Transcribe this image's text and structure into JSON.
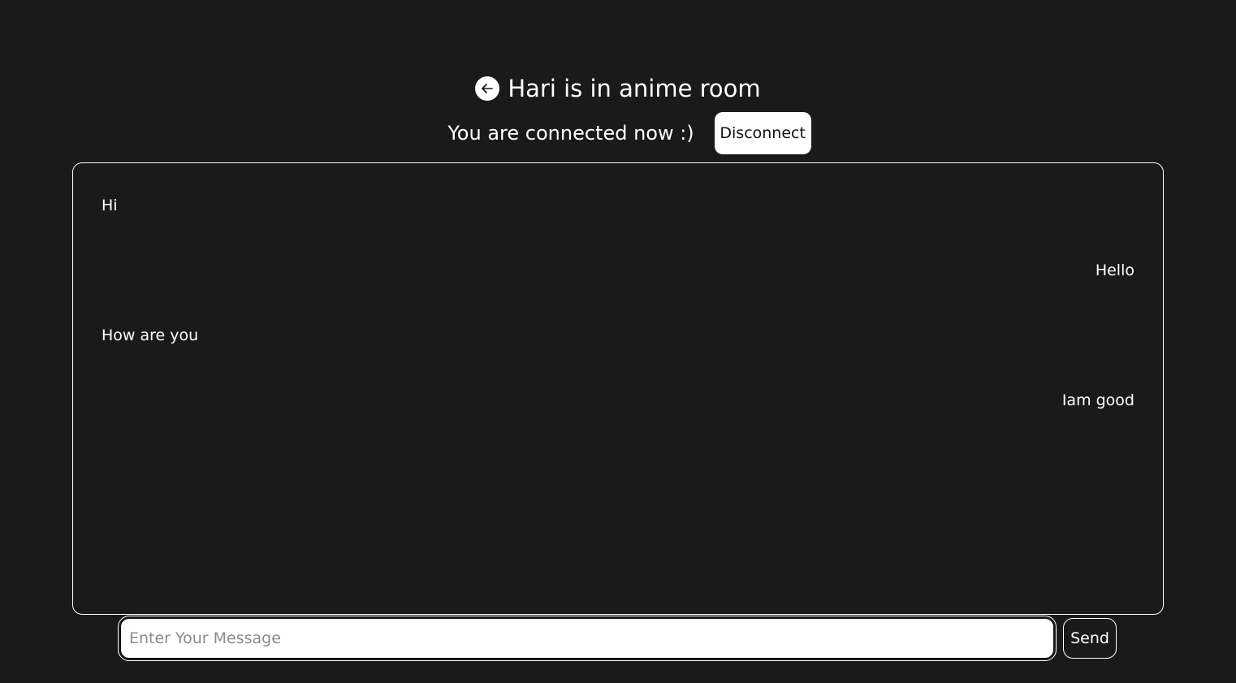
{
  "header": {
    "back_icon": "arrow-left-icon",
    "title": "Hari is in anime room"
  },
  "status": {
    "text": "You are connected now :)",
    "disconnect_label": "Disconnect"
  },
  "messages": [
    {
      "text": "Hi",
      "side": "left"
    },
    {
      "text": "Hello",
      "side": "right"
    },
    {
      "text": "How are you",
      "side": "left"
    },
    {
      "text": "Iam good",
      "side": "right"
    }
  ],
  "composer": {
    "placeholder": "Enter Your Message",
    "value": "",
    "send_label": "Send"
  },
  "colors": {
    "background": "#1a1a1a",
    "text": "#ffffff",
    "button_bg": "#ffffff"
  }
}
